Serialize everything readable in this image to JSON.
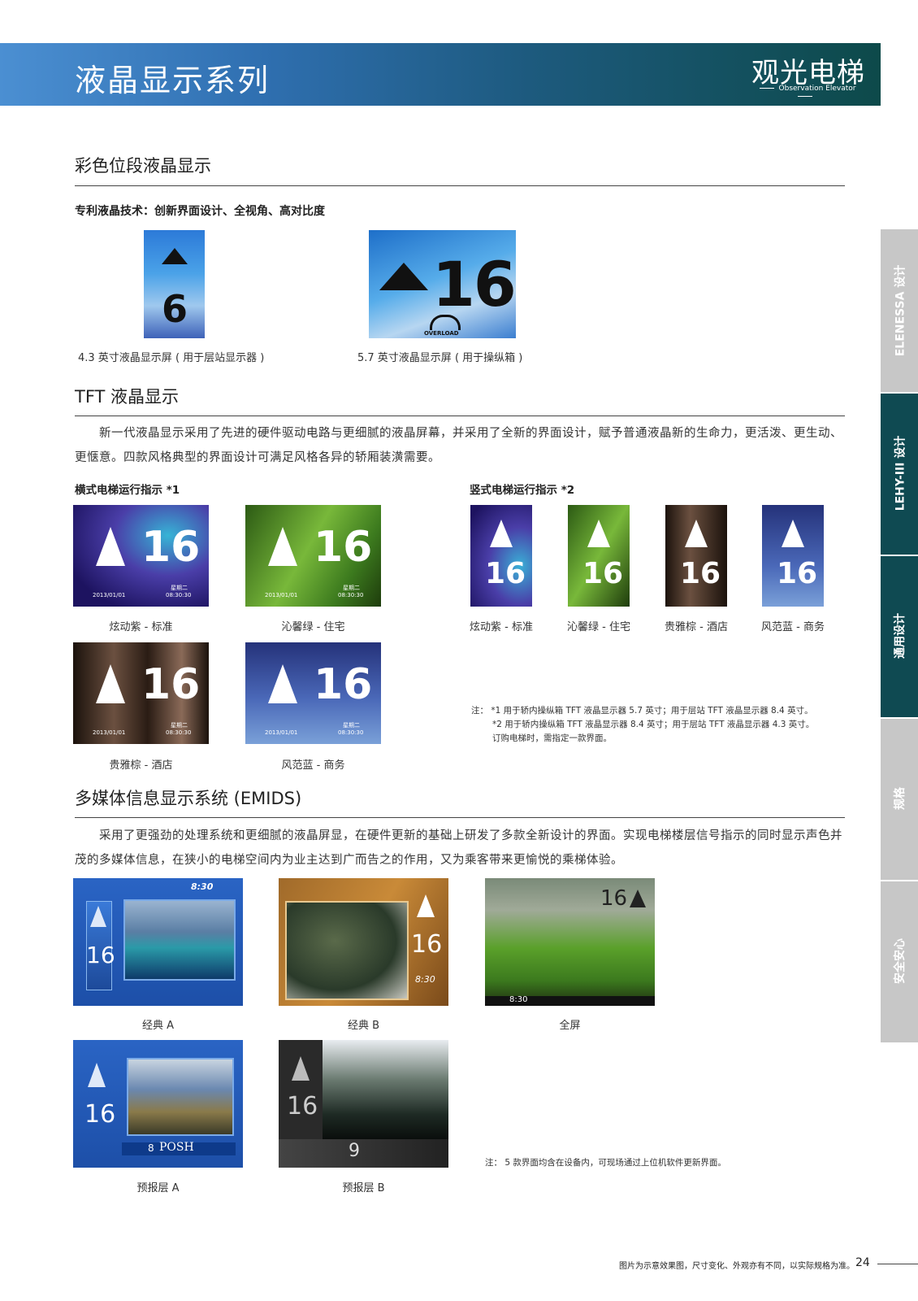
{
  "header": {
    "title": "液晶显示系列",
    "brand": "观光电梯",
    "brand_sub": "Observation Elevator"
  },
  "section1": {
    "title": "彩色位段液晶显示",
    "subtitle": "专利液晶技术：创新界面设计、全视角、高对比度",
    "items": [
      {
        "floor": "6",
        "caption": "4.3 英寸液晶显示屏 ( 用于层站显示器 )"
      },
      {
        "floor": "16",
        "badge": "OVERLOAD",
        "caption": "5.7 英寸液晶显示屏 ( 用于操纵箱 )"
      }
    ]
  },
  "section2": {
    "title_prefix": "TFT",
    "title": " 液晶显示",
    "body": "新一代液晶显示采用了先进的硬件驱动电路与更细腻的液晶屏幕，并采用了全新的界面设计，赋予普通液晶新的生命力，更活泼、更生动、更惬意。四款风格典型的界面设计可满足风格各异的轿厢装潢需要。",
    "horizontal_label": "横式电梯运行指示 *1",
    "vertical_label": "竖式电梯运行指示 *2",
    "floor": "16",
    "date": "2013/01/01",
    "weekday": "星期二",
    "time": "08:30:30",
    "horizontal": [
      {
        "caption": "炫动紫 - 标准"
      },
      {
        "caption": "沁馨绿 - 住宅"
      },
      {
        "caption": "贵雅棕 - 酒店"
      },
      {
        "caption": "风范蓝 - 商务"
      }
    ],
    "vertical": [
      {
        "caption": "炫动紫 - 标准"
      },
      {
        "caption": "沁馨绿 - 住宅"
      },
      {
        "caption": "贵雅棕 - 酒店"
      },
      {
        "caption": "风范蓝 - 商务"
      }
    ],
    "notes": [
      "注：  *1  用于轿内操纵箱 TFT 液晶显示器 5.7 英寸；用于层站 TFT 液晶显示器 8.4 英寸。",
      "*2  用于轿内操纵箱 TFT 液晶显示器 8.4 英寸；用于层站 TFT 液晶显示器 4.3 英寸。",
      "订购电梯时，需指定一款界面。"
    ]
  },
  "section3": {
    "title": "多媒体信息显示系统",
    "title_suffix": " (EMIDS)",
    "body": "采用了更强劲的处理系统和更细腻的液晶屏显，在硬件更新的基础上研发了多款全新设计的界面。实现电梯楼层信号指示的同时显示声色并茂的多媒体信息，在狭小的电梯空间内为业主达到广而告之的作用，又为乘客带来更愉悦的乘梯体验。",
    "floor": "16",
    "time_a": "8:30",
    "time_b": "8:30",
    "time_c": "8:30",
    "next_floor": "8",
    "posh": "POSH",
    "floor_b": "9",
    "items": [
      {
        "caption": "经典 A"
      },
      {
        "caption": "经典 B"
      },
      {
        "caption": "全屏"
      },
      {
        "caption": "预报层 A"
      },
      {
        "caption": "预报层 B"
      }
    ],
    "note": "注：  5 款界面均含在设备内，可现场通过上位机软件更新界面。"
  },
  "side_tabs": [
    "ELENESSA 设计",
    "LEHY-III 设计",
    "通用设计",
    "规格",
    "安全安心"
  ],
  "footer": {
    "note": "图片为示意效果图，尺寸变化、外观亦有不同，以实际规格为准。",
    "page": "24"
  }
}
